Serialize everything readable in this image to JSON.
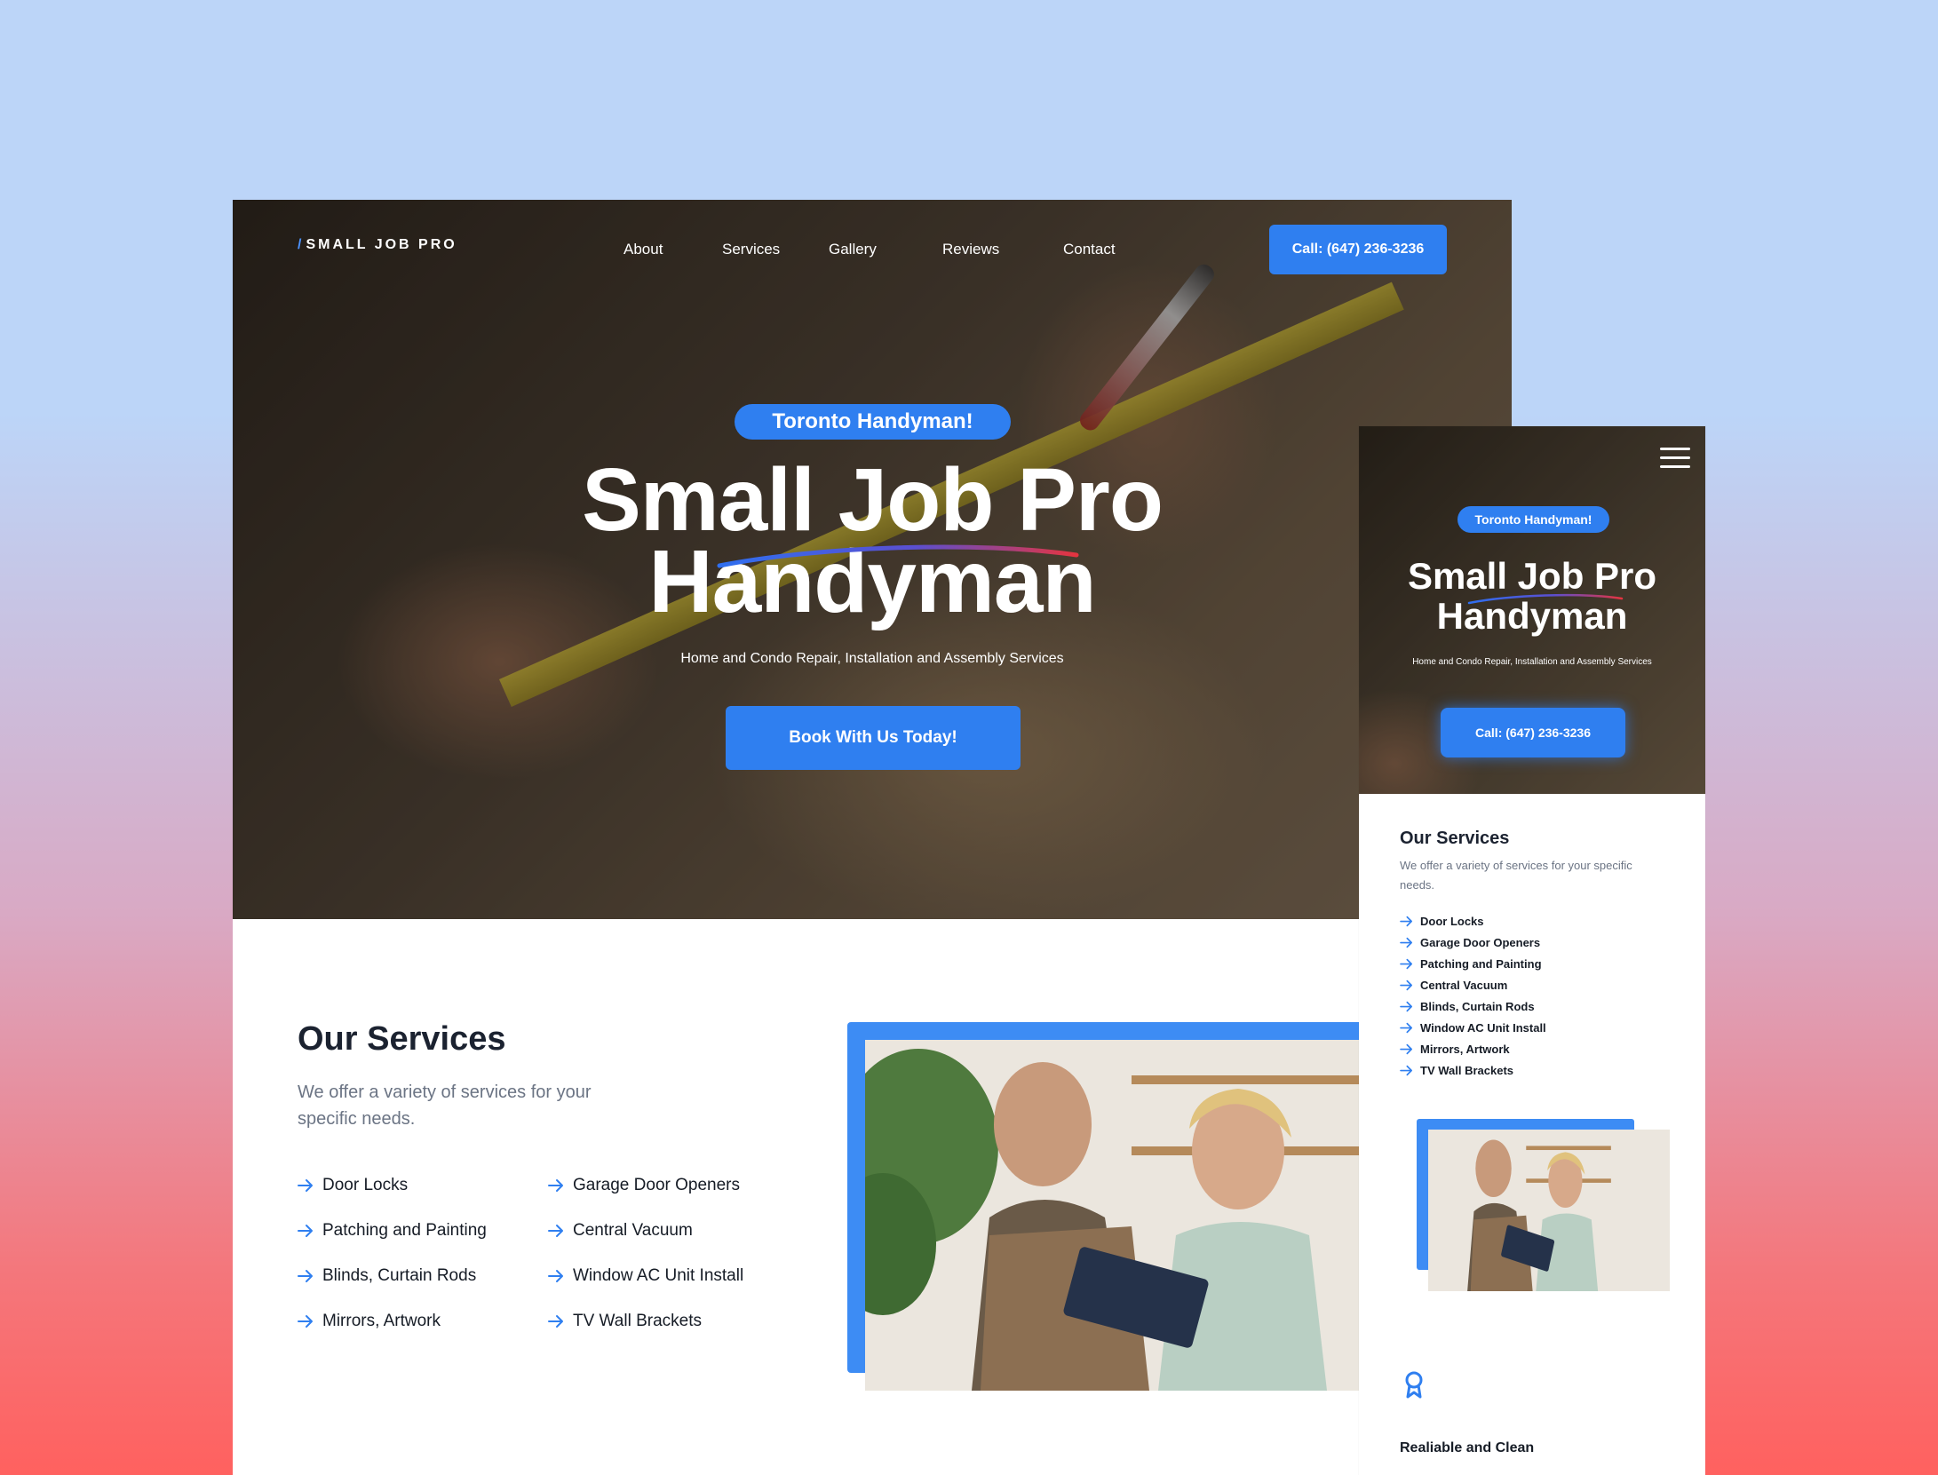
{
  "desktop": {
    "logo": {
      "slash": "/",
      "text": "SMALL JOB PRO"
    },
    "nav": [
      "About",
      "Services",
      "Gallery",
      "Reviews",
      "Contact"
    ],
    "call_button": "Call: (647) 236-3236",
    "hero": {
      "badge": "Toronto Handyman!",
      "title_line1": "Small Job Pro",
      "title_line2": "Handyman",
      "subtitle": "Home and Condo Repair, Installation and Assembly Services",
      "cta": "Book With Us Today!"
    },
    "services": {
      "title": "Our Services",
      "description": "We offer a variety of services for your specific needs.",
      "items": [
        "Door Locks",
        "Garage Door Openers",
        "Patching and Painting",
        "Central Vacuum",
        "Blinds, Curtain Rods",
        "Window AC Unit Install",
        "Mirrors, Artwork",
        "TV Wall Brackets"
      ]
    }
  },
  "mobile": {
    "hero": {
      "badge": "Toronto Handyman!",
      "title_line1": "Small Job Pro",
      "title_line2": "Handyman",
      "subtitle": "Home and Condo Repair, Installation and Assembly Services",
      "cta": "Call: (647) 236-3236"
    },
    "services": {
      "title": "Our Services",
      "description": "We offer a variety of services for your specific needs.",
      "items": [
        "Door Locks",
        "Garage Door Openers",
        "Patching and Painting",
        "Central Vacuum",
        "Blinds, Curtain Rods",
        "Window AC Unit Install",
        "Mirrors, Artwork",
        "TV Wall Brackets"
      ]
    },
    "feature": {
      "title": "Realiable and Clean",
      "icon": "award-ribbon-icon"
    }
  },
  "colors": {
    "accent": "#2f7ff0",
    "swoosh_blue": "#2f6ff0",
    "swoosh_red": "#e5343f",
    "text_dark": "#1b2230",
    "text_muted": "#6b7484"
  },
  "icons": {
    "menu": "hamburger-menu-icon",
    "list_bullet": "arrow-right-icon"
  }
}
